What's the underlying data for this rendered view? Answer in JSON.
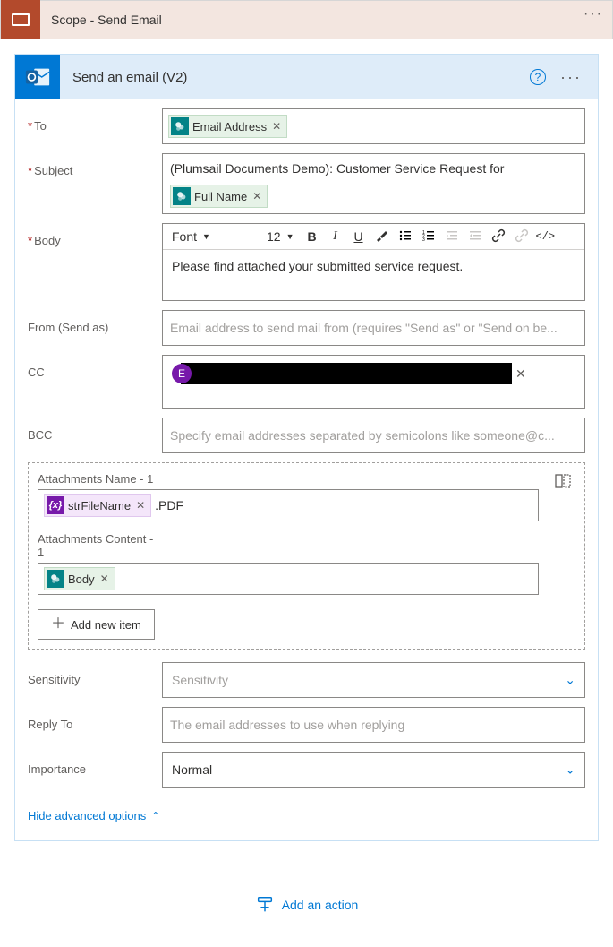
{
  "scope": {
    "title": "Scope - Send Email"
  },
  "action": {
    "title": "Send an email (V2)"
  },
  "fields": {
    "to_label": "To",
    "to_token": "Email Address",
    "subject_label": "Subject",
    "subject_text_prefix": "(Plumsail Documents Demo): Customer Service Request for",
    "subject_token": "Full Name",
    "body_label": "Body",
    "body_text": "Please find attached your submitted service request.",
    "from_label": "From (Send as)",
    "from_placeholder": "Email address to send mail from (requires \"Send as\" or \"Send on be...",
    "cc_label": "CC",
    "cc_avatar_initial": "E",
    "bcc_label": "BCC",
    "bcc_placeholder": "Specify email addresses separated by semicolons like someone@c...",
    "attach_name_label": "Attachments Name - 1",
    "attach_name_token": "strFileName",
    "attach_name_suffix": ".PDF",
    "attach_content_label": "Attachments Content - 1",
    "attach_content_token": "Body",
    "add_item_label": "Add new item",
    "sensitivity_label": "Sensitivity",
    "sensitivity_placeholder": "Sensitivity",
    "replyto_label": "Reply To",
    "replyto_placeholder": "The email addresses to use when replying",
    "importance_label": "Importance",
    "importance_value": "Normal"
  },
  "rte": {
    "font_label": "Font",
    "size_label": "12"
  },
  "links": {
    "hide_advanced": "Hide advanced options",
    "add_action": "Add an action"
  }
}
